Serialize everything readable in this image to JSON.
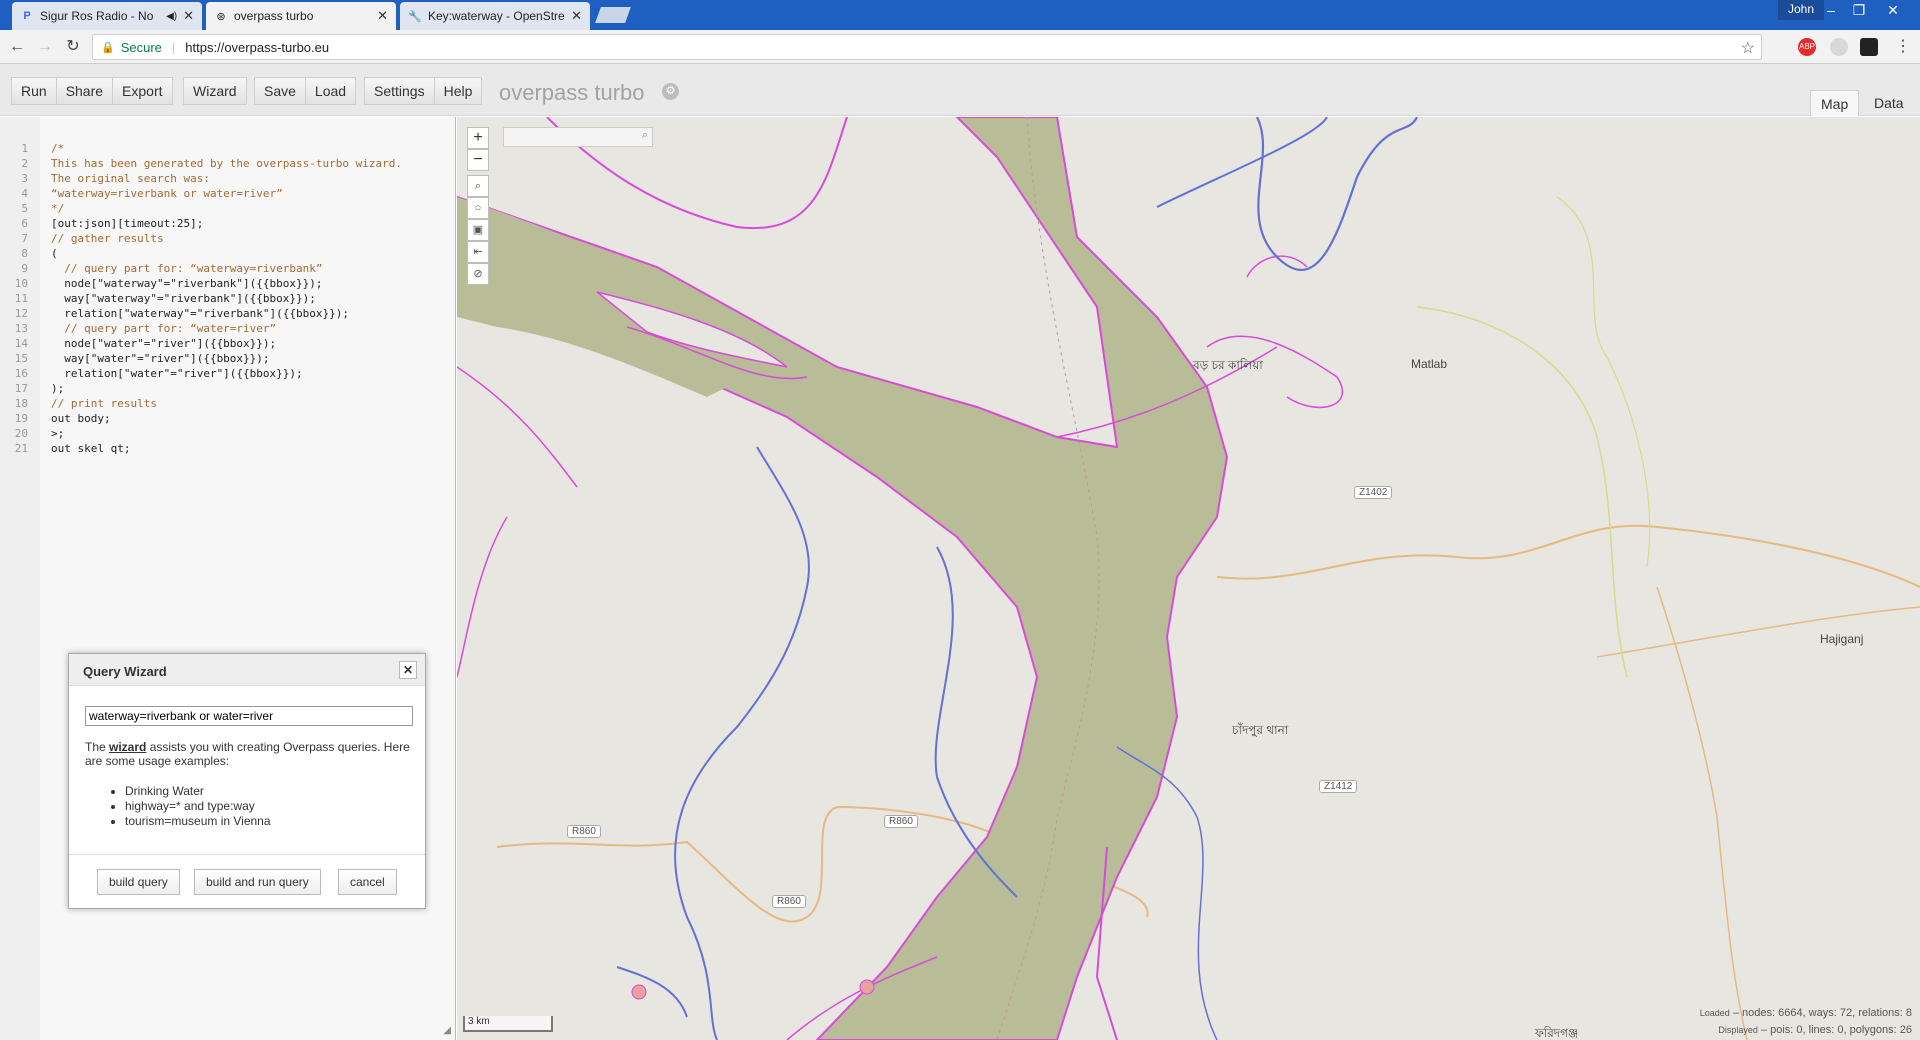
{
  "browser": {
    "tabs": [
      {
        "title": "Sigur Ros Radio - No",
        "active": false
      },
      {
        "title": "overpass turbo",
        "active": true
      },
      {
        "title": "Key:waterway - OpenStre",
        "active": false
      }
    ],
    "user": "John",
    "secure_label": "Secure",
    "url": "https://overpass-turbo.eu",
    "ext_abp": "ABP"
  },
  "toolbar": {
    "run": "Run",
    "share": "Share",
    "export": "Export",
    "wizard": "Wizard",
    "save": "Save",
    "load": "Load",
    "settings": "Settings",
    "help": "Help",
    "brand": "overpass turbo",
    "tab_map": "Map",
    "tab_data": "Data"
  },
  "editor": {
    "lines": [
      {
        "n": "1",
        "t": "/*",
        "c": true
      },
      {
        "n": "2",
        "t": "This has been generated by the overpass-turbo wizard.",
        "c": true
      },
      {
        "n": "3",
        "t": "The original search was:",
        "c": true
      },
      {
        "n": "4",
        "t": "“waterway=riverbank or water=river”",
        "c": true
      },
      {
        "n": "5",
        "t": "*/",
        "c": true
      },
      {
        "n": "6",
        "t": "[out:json][timeout:25];",
        "c": false
      },
      {
        "n": "7",
        "t": "// gather results",
        "c": true
      },
      {
        "n": "8",
        "t": "(",
        "c": false
      },
      {
        "n": "9",
        "t": "  // query part for: “waterway=riverbank”",
        "c": true
      },
      {
        "n": "10",
        "t": "  node[\"waterway\"=\"riverbank\"]({{bbox}});",
        "c": false
      },
      {
        "n": "11",
        "t": "  way[\"waterway\"=\"riverbank\"]({{bbox}});",
        "c": false
      },
      {
        "n": "12",
        "t": "  relation[\"waterway\"=\"riverbank\"]({{bbox}});",
        "c": false
      },
      {
        "n": "13",
        "t": "  // query part for: “water=river”",
        "c": true
      },
      {
        "n": "14",
        "t": "  node[\"water\"=\"river\"]({{bbox}});",
        "c": false
      },
      {
        "n": "15",
        "t": "  way[\"water\"=\"river\"]({{bbox}});",
        "c": false
      },
      {
        "n": "16",
        "t": "  relation[\"water\"=\"river\"]({{bbox}});",
        "c": false
      },
      {
        "n": "17",
        "t": ");",
        "c": false
      },
      {
        "n": "18",
        "t": "// print results",
        "c": true
      },
      {
        "n": "19",
        "t": "out body;",
        "c": false
      },
      {
        "n": "20",
        "t": ">;",
        "c": false
      },
      {
        "n": "21",
        "t": "out skel qt;",
        "c": false
      }
    ]
  },
  "wizard": {
    "title": "Query Wizard",
    "input_value": "waterway=riverbank or water=river",
    "desc_prefix": "The ",
    "desc_link": "wizard",
    "desc_suffix": " assists you with creating Overpass queries. Here are some usage examples:",
    "examples": [
      "Drinking Water",
      "highway=* and type:way",
      "tourism=museum in Vienna"
    ],
    "btn_build": "build query",
    "btn_build_run": "build and run query",
    "btn_cancel": "cancel"
  },
  "map": {
    "labels": {
      "boro_char": "বড় চর কালিয়া",
      "matlab": "Matlab",
      "hajiganj": "Hajiganj",
      "chandpur": "চাঁদপুর থানা",
      "faridganj": "ফরিদগঞ্জ"
    },
    "shields": {
      "z1402": "Z1402",
      "z1412": "Z1412",
      "r860a": "R860",
      "r860b": "R860",
      "r860c": "R860"
    },
    "scale": "3 km",
    "stats_loaded_label": "Loaded",
    "stats_loaded": "– nodes: 6664, ways: 72, relations: 8",
    "stats_displayed_label": "Displayed",
    "stats_displayed": "– pois: 0, lines: 0, polygons: 26",
    "colors": {
      "river_fill": "#b8bd98",
      "outline": "#d94ad9",
      "stream": "#6470d4",
      "road": "#e6b981"
    }
  }
}
